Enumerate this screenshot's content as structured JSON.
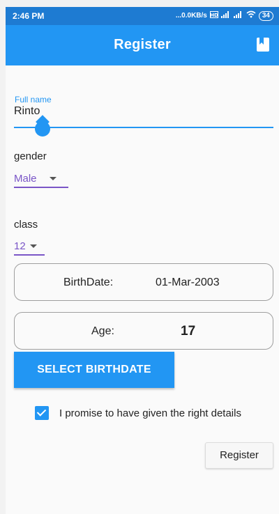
{
  "status_bar": {
    "time": "2:46 PM",
    "network": "...0.0KB/s",
    "network_icons": [
      "hd-volte-icon",
      "signal-icon",
      "signal-icon",
      "wifi-icon"
    ],
    "battery": "34"
  },
  "app_bar": {
    "title": "Register",
    "action_icon": "bookmark-icon"
  },
  "form": {
    "full_name": {
      "label": "Full name",
      "value": "Rinto"
    },
    "gender": {
      "label": "gender",
      "selected": "Male"
    },
    "class": {
      "label": "class",
      "selected": "12"
    },
    "birthdate": {
      "label": "BirthDate:",
      "value": "01-Mar-2003"
    },
    "age": {
      "label": "Age:",
      "value": "17"
    },
    "select_birthdate_label": "SELECT BIRTHDATE",
    "agreement": {
      "checked": true,
      "label": "I promise to have given the right details"
    },
    "register_label": "Register"
  },
  "colors": {
    "status_bar": "#1e7bd2",
    "app_bar": "#2296f3",
    "accent": "#2296f3",
    "dropdown_accent": "#7a55c7",
    "background": "#fafafa"
  }
}
